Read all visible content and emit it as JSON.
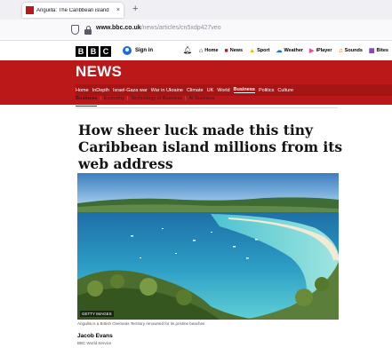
{
  "browser": {
    "tab_title": "Anguilla: The Caribbean island",
    "tab_close": "×",
    "new_tab": "+",
    "url_domain": "www.bbc.co.uk",
    "url_path": "/news/articles/cn5xdp427veo"
  },
  "bbc_header": {
    "logo": [
      "B",
      "B",
      "C"
    ],
    "sign_in": "Sign in",
    "nav": [
      {
        "label": "Home",
        "icon": "home-icon",
        "color": "#000000"
      },
      {
        "label": "News",
        "icon": "news-icon",
        "color": "#bb1919"
      },
      {
        "label": "Sport",
        "icon": "sport-icon",
        "color": "#ffd230"
      },
      {
        "label": "Weather",
        "icon": "weather-icon",
        "color": "#1e6bd6"
      },
      {
        "label": "iPlayer",
        "icon": "iplayer-icon",
        "color": "#f54997"
      },
      {
        "label": "Sounds",
        "icon": "sounds-icon",
        "color": "#ff6600"
      },
      {
        "label": "Bites",
        "icon": "bites-icon",
        "color": "#7a2fb8"
      }
    ]
  },
  "news": {
    "title": "NEWS",
    "brand_color": "#bb1919",
    "nav": [
      "Home",
      "InDepth",
      "Israel-Gaza war",
      "War in Ukraine",
      "Climate",
      "UK",
      "World",
      "Business",
      "Politics",
      "Culture"
    ],
    "active_nav": "Business",
    "subnav": [
      "Business",
      "Economy",
      "Technology of Business",
      "AI Business"
    ],
    "active_subnav": "Business"
  },
  "article": {
    "headline": "How sheer luck made this tiny Caribbean island millions from its web address",
    "image_credit": "GETTY IMAGES",
    "caption": "Anguilla is a British Overseas Territory renowned for its pristine beaches",
    "author_name": "Jacob Evans",
    "author_org": "BBC World Service"
  }
}
